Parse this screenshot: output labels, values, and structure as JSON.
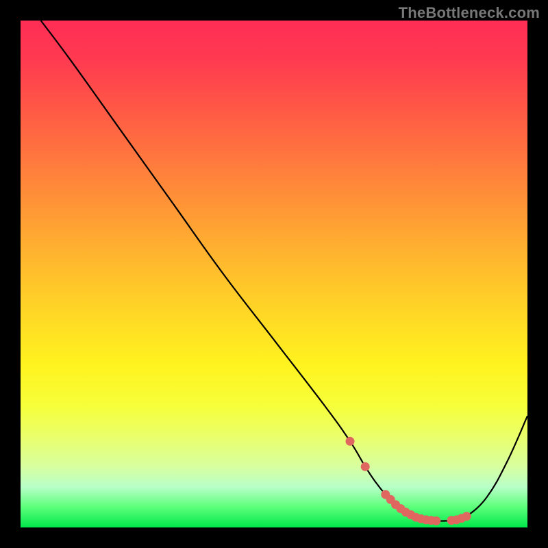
{
  "watermark": "TheBottleneck.com",
  "chart_data": {
    "type": "line",
    "title": "",
    "xlabel": "",
    "ylabel": "",
    "xlim": [
      0,
      100
    ],
    "ylim": [
      0,
      100
    ],
    "grid": false,
    "legend": false,
    "series": [
      {
        "name": "bottleneck-curve",
        "x": [
          4,
          10,
          20,
          30,
          40,
          50,
          60,
          65,
          68,
          70,
          72,
          74,
          76,
          78,
          80,
          82,
          84,
          86,
          88,
          92,
          96,
          100
        ],
        "y": [
          100,
          92,
          78,
          64,
          50,
          37,
          24,
          17,
          12,
          9,
          6.5,
          4.5,
          3,
          2,
          1.5,
          1.3,
          1.3,
          1.5,
          2.2,
          6,
          13,
          22
        ]
      }
    ],
    "markers": {
      "name": "highlighted-points",
      "color": "#e0675f",
      "x": [
        65,
        68,
        72,
        73,
        74,
        75,
        76,
        77,
        78,
        79,
        80,
        81,
        82,
        85,
        86,
        87,
        88
      ],
      "y": [
        17,
        12,
        6.5,
        5.5,
        4.5,
        3.7,
        3,
        2.5,
        2,
        1.7,
        1.5,
        1.4,
        1.3,
        1.4,
        1.5,
        1.8,
        2.2
      ]
    }
  }
}
